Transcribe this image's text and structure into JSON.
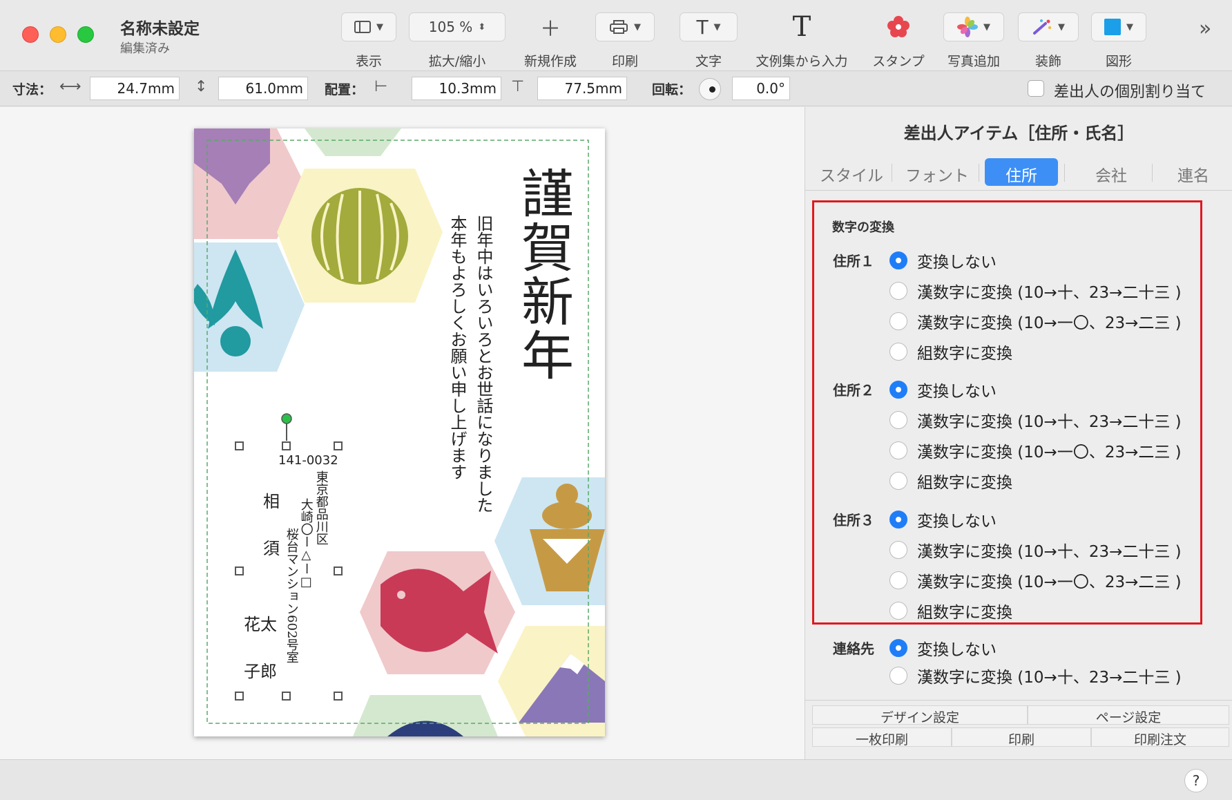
{
  "window": {
    "title": "名称未設定",
    "subtitle": "編集済み"
  },
  "toolbar": {
    "view_label": "表示",
    "zoom_value": "105 %",
    "zoom_label": "拡大/縮小",
    "new_label": "新規作成",
    "print_label": "印刷",
    "text_label": "文字",
    "text_icon": "T",
    "phrase_label": "文例集から入力",
    "phrase_icon": "T",
    "stamp_label": "スタンプ",
    "photo_label": "写真追加",
    "decor_label": "装飾",
    "shape_label": "図形",
    "shape_color": "#1a9fe8"
  },
  "dimensions": {
    "size_label": "寸法：",
    "width_value": "24.7mm",
    "height_value": "61.0mm",
    "position_label": "配置：",
    "x_value": "10.3mm",
    "y_value": "77.5mm",
    "rotation_label": "回転：",
    "rotation_value": "0.0°",
    "individual_label": "差出人の個別割り当て"
  },
  "card": {
    "title": "謹賀新年",
    "line1": "旧年中はいろいろとお世話になりました",
    "line2": "本年もよろしくお願い申し上げます",
    "zipcode": "141-0032",
    "address1": "東京都品川区",
    "address2": "大崎〇ー△ー□",
    "address3": "桜台マンション602号室",
    "name_chars": [
      "相",
      "須",
      "花太",
      "子郎"
    ]
  },
  "panel": {
    "title": "差出人アイテム［住所・氏名］",
    "tabs": [
      "スタイル",
      "フォント",
      "住所",
      "会社",
      "連名"
    ],
    "active_tab": "住所",
    "section_title": "数字の変換",
    "groups": [
      {
        "label": "住所１",
        "options": [
          "変換しない",
          "漢数字に変換 (10→十、23→二十三 )",
          "漢数字に変換 (10→一〇、23→二三 )",
          "組数字に変換"
        ]
      },
      {
        "label": "住所２",
        "options": [
          "変換しない",
          "漢数字に変換 (10→十、23→二十三 )",
          "漢数字に変換 (10→一〇、23→二三 )",
          "組数字に変換"
        ]
      },
      {
        "label": "住所３",
        "options": [
          "変換しない",
          "漢数字に変換 (10→十、23→二十三 )",
          "漢数字に変換 (10→一〇、23→二三 )",
          "組数字に変換"
        ]
      }
    ],
    "contact": {
      "label": "連絡先",
      "options": [
        "変換しない",
        "漢数字に変換 (10→十、23→二十三 )"
      ]
    },
    "bottom": {
      "design": "デザイン設定",
      "page": "ページ設定",
      "single_print": "一枚印刷",
      "print": "印刷",
      "order": "印刷注文"
    },
    "highlight_color": "#e0181f",
    "accent_color": "#3d8ff6"
  },
  "help_label": "?"
}
